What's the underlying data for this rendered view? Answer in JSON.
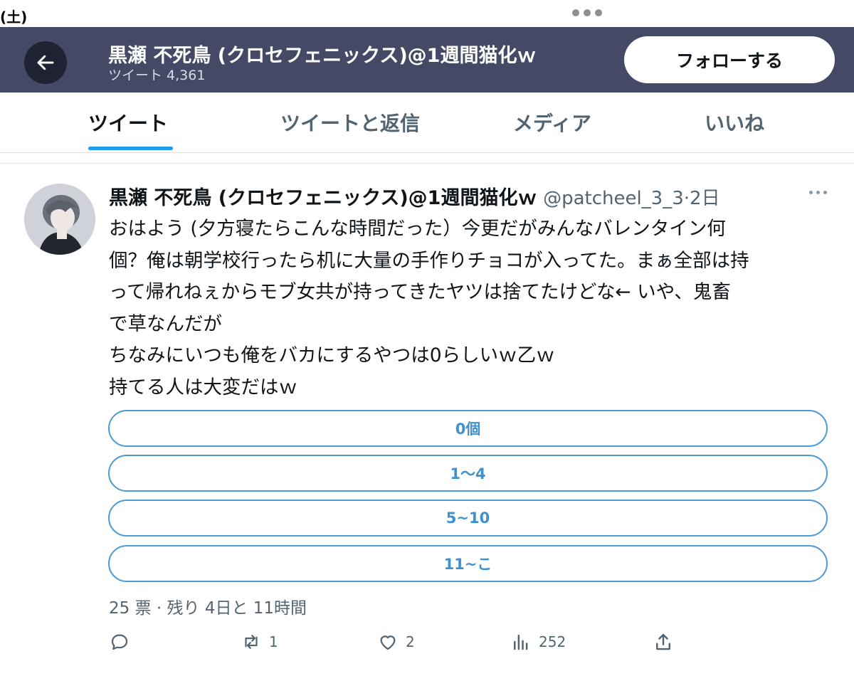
{
  "status_bar": {
    "time": "(土)"
  },
  "header": {
    "title": "黒瀬 不死鳥 (クロセフェニックス)@1週間猫化ｗ",
    "tweet_count": "ツイート 4,361",
    "follow_label": "フォローする"
  },
  "tabs": [
    {
      "label": "ツイート",
      "active": true
    },
    {
      "label": "ツイートと返信",
      "active": false
    },
    {
      "label": "メディア",
      "active": false
    },
    {
      "label": "いいね",
      "active": false
    }
  ],
  "tweet": {
    "name": "黒瀬 不死鳥 (クロセフェニックス)@1週間猫化ｗ",
    "handle": "@patcheel_3_3",
    "time": "·2日",
    "lines": [
      "おはよう (夕方寝たらこんな時間だった）今更だがみんなバレンタイン何",
      "個？俺は朝学校行ったら机に大量の手作りチョコが入ってた。まぁ全部は持",
      "って帰れねぇからモブ女共が持ってきたヤツは捨てたけどな← いや、鬼畜",
      "で草なんだが",
      "ちなみにいつも俺をバカにするやつは0らしいｗ乙ｗ",
      "持てる人は大変だはｗ"
    ],
    "poll": {
      "options": [
        "0個",
        "1〜4",
        "5~10",
        "11~こ"
      ],
      "info": "25 票 · 残り 4日と 11時間"
    },
    "actions": {
      "reply_icon": "reply-icon",
      "retweet_count": "1",
      "like_count": "2",
      "views_count": "252"
    }
  },
  "colors": {
    "header_bg": "#444a66",
    "accent": "#1d9bf0",
    "poll_border": "#4a9ad6"
  }
}
